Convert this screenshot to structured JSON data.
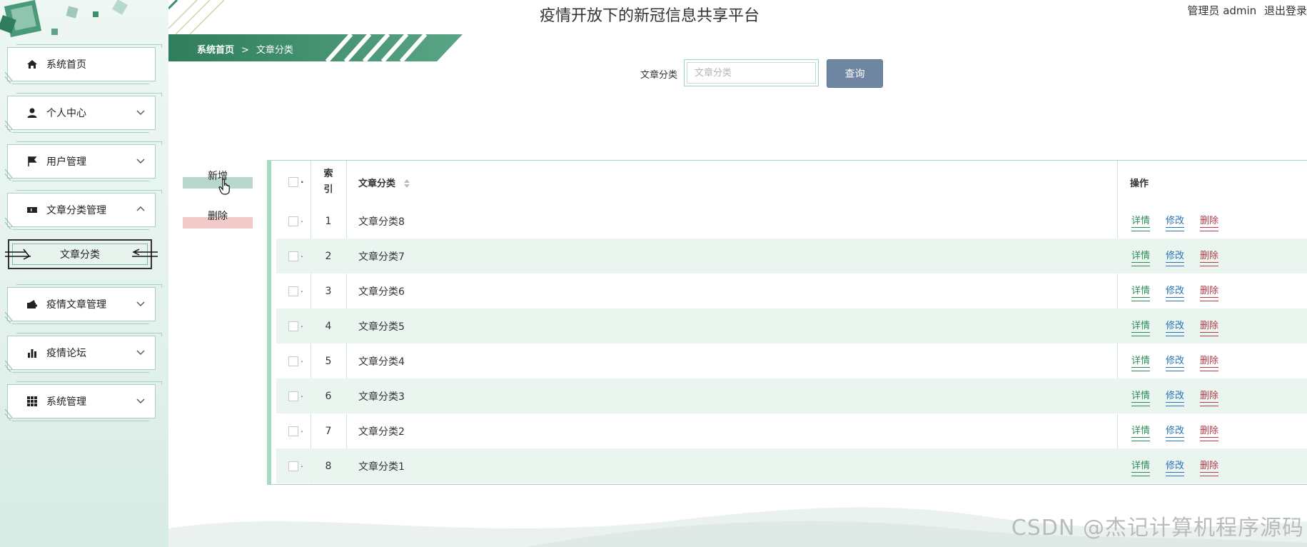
{
  "header": {
    "title": "疫情开放下的新冠信息共享平台",
    "user_role": "管理员 admin",
    "logout": "退出登录"
  },
  "sidebar": {
    "items": [
      {
        "label": "系统首页",
        "icon": "home-icon",
        "expandable": false
      },
      {
        "label": "个人中心",
        "icon": "user-icon",
        "expandable": true,
        "expanded": false
      },
      {
        "label": "用户管理",
        "icon": "flag-icon",
        "expandable": true,
        "expanded": false
      },
      {
        "label": "文章分类管理",
        "icon": "ticket-icon",
        "expandable": true,
        "expanded": true
      },
      {
        "label": "疫情文章管理",
        "icon": "wallet-icon",
        "expandable": true,
        "expanded": false
      },
      {
        "label": "疫情论坛",
        "icon": "bar-chart-icon",
        "expandable": true,
        "expanded": false
      },
      {
        "label": "系统管理",
        "icon": "grid-icon",
        "expandable": true,
        "expanded": false
      }
    ],
    "submenu": {
      "label": "文章分类"
    }
  },
  "breadcrumb": {
    "home": "系统首页",
    "separator": ">",
    "current": "文章分类"
  },
  "search": {
    "label": "文章分类",
    "placeholder": "文章分类",
    "value": "",
    "button": "查询"
  },
  "actions": {
    "add": "新增",
    "delete": "删除"
  },
  "table": {
    "headers": {
      "index": "索引",
      "name": "文章分类",
      "ops": "操作"
    },
    "rows": [
      {
        "index": "1",
        "name": "文章分类8"
      },
      {
        "index": "2",
        "name": "文章分类7"
      },
      {
        "index": "3",
        "name": "文章分类6"
      },
      {
        "index": "4",
        "name": "文章分类5"
      },
      {
        "index": "5",
        "name": "文章分类4"
      },
      {
        "index": "6",
        "name": "文章分类3"
      },
      {
        "index": "7",
        "name": "文章分类2"
      },
      {
        "index": "8",
        "name": "文章分类1"
      }
    ],
    "ops": {
      "detail": "详情",
      "edit": "修改",
      "delete": "删除"
    }
  },
  "watermark": "CSDN @杰记计算机程序源码",
  "colors": {
    "brand_green": "#3d8f6c",
    "search_button": "#6f86a3",
    "detail_link": "#2e8b57",
    "edit_link": "#2a72b5",
    "delete_link": "#b43c4a",
    "row_alt": "#eaf5f0"
  }
}
